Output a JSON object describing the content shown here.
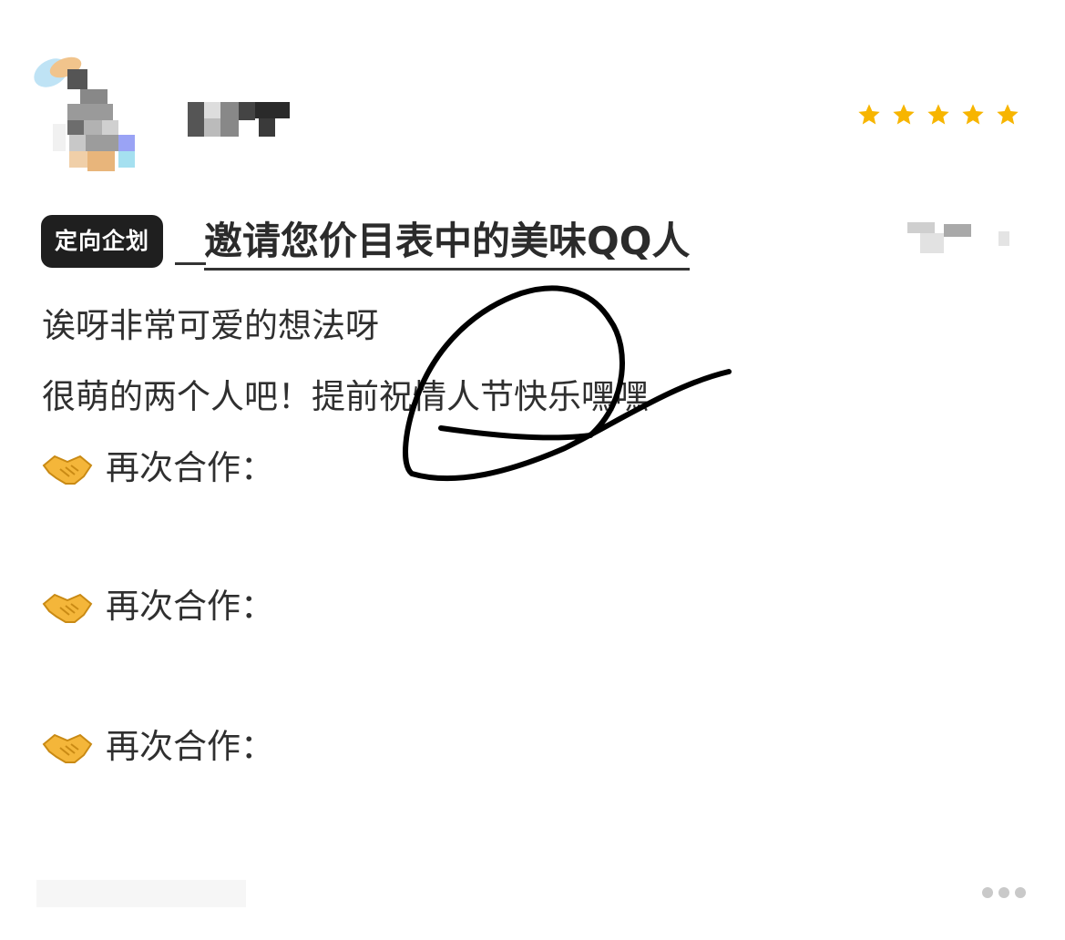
{
  "review": {
    "tag": "定向企划",
    "title": "邀请您价目表中的美味QQ人",
    "rating": 5,
    "lines": [
      "诶呀非常可爱的想法呀",
      "很萌的两个人吧！提前祝情人节快乐嘿嘿"
    ],
    "cooperation": [
      {
        "icon": "handshake-icon",
        "label": "再次合作："
      },
      {
        "icon": "handshake-icon",
        "label": "再次合作："
      },
      {
        "icon": "handshake-icon",
        "label": "再次合作："
      }
    ]
  },
  "colors": {
    "star": "#F7B500",
    "tag_bg": "#1F1F1F",
    "handshake": "#F4B63A"
  },
  "icons": {
    "rating": "star-icon",
    "more": "more-dots-icon",
    "annotation": "hand-drawn-circle-scribble"
  }
}
